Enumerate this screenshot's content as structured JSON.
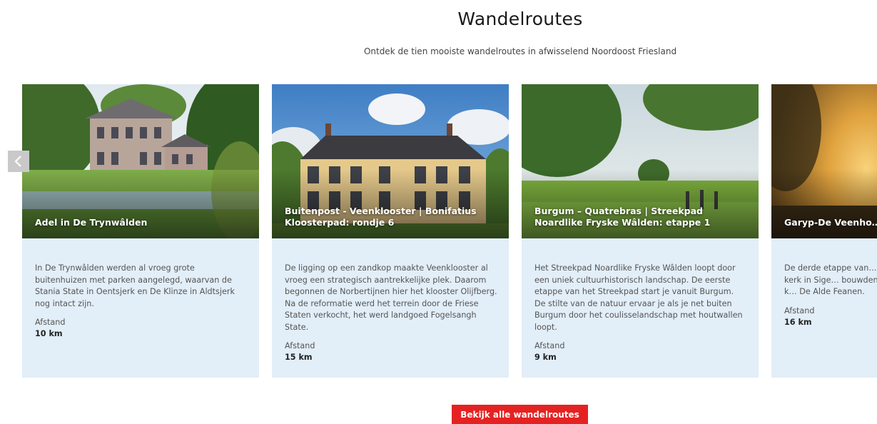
{
  "header": {
    "title": "Wandelroutes",
    "subtitle": "Ontdek de tien mooiste wandelroutes in afwisselend Noordoost Friesland"
  },
  "carousel": {
    "prev_icon": "chevron-left-icon",
    "cards": [
      {
        "title": "Adel in De Trynwâlden",
        "description": "In De Trynwâlden werden al vroeg grote buitenhuizen met parken aangelegd, waarvan de Stania State in Oentsjerk en De Klinze in Aldtsjerk nog intact zijn.",
        "distance_label": "Afstand",
        "distance_value": "10 km"
      },
      {
        "title": "Buitenpost - Veenklooster | Bonifatius Kloosterpad: rondje 6",
        "description": "De ligging op een zandkop maakte Veenklooster al vroeg een strategisch aantrekkelijke plek. Daarom begonnen de Norbertijnen hier het klooster Olijfberg. Na de reformatie werd het terrein door de Friese Staten verkocht, het werd landgoed Fogelsangh State.",
        "distance_label": "Afstand",
        "distance_value": "15 km"
      },
      {
        "title": "Burgum – Quatrebras | Streekpad Noardlike Fryske Wâlden: etappe 1",
        "description": "Het Streekpad Noardlike Fryske Wâlden loopt door een uniek cultuurhistorisch landschap. De eerste etappe van het Streekpad start je vanuit Burgum. De stilte van de natuur ervaar je als je net buiten Burgum door het coulisselandschap met houtwallen loopt.",
        "distance_label": "Afstand",
        "distance_value": "9 km"
      },
      {
        "title": "Garyp-De Veenho… Kloosterpad: etap…",
        "description": "De derde etappe van… staat in het teken vo… vervallen kerk in Sige… bouwden om armen… Bovendien maak je k… De Alde Feanen.",
        "distance_label": "Afstand",
        "distance_value": "16 km"
      }
    ]
  },
  "cta": {
    "label": "Bekijk alle wandelroutes"
  }
}
